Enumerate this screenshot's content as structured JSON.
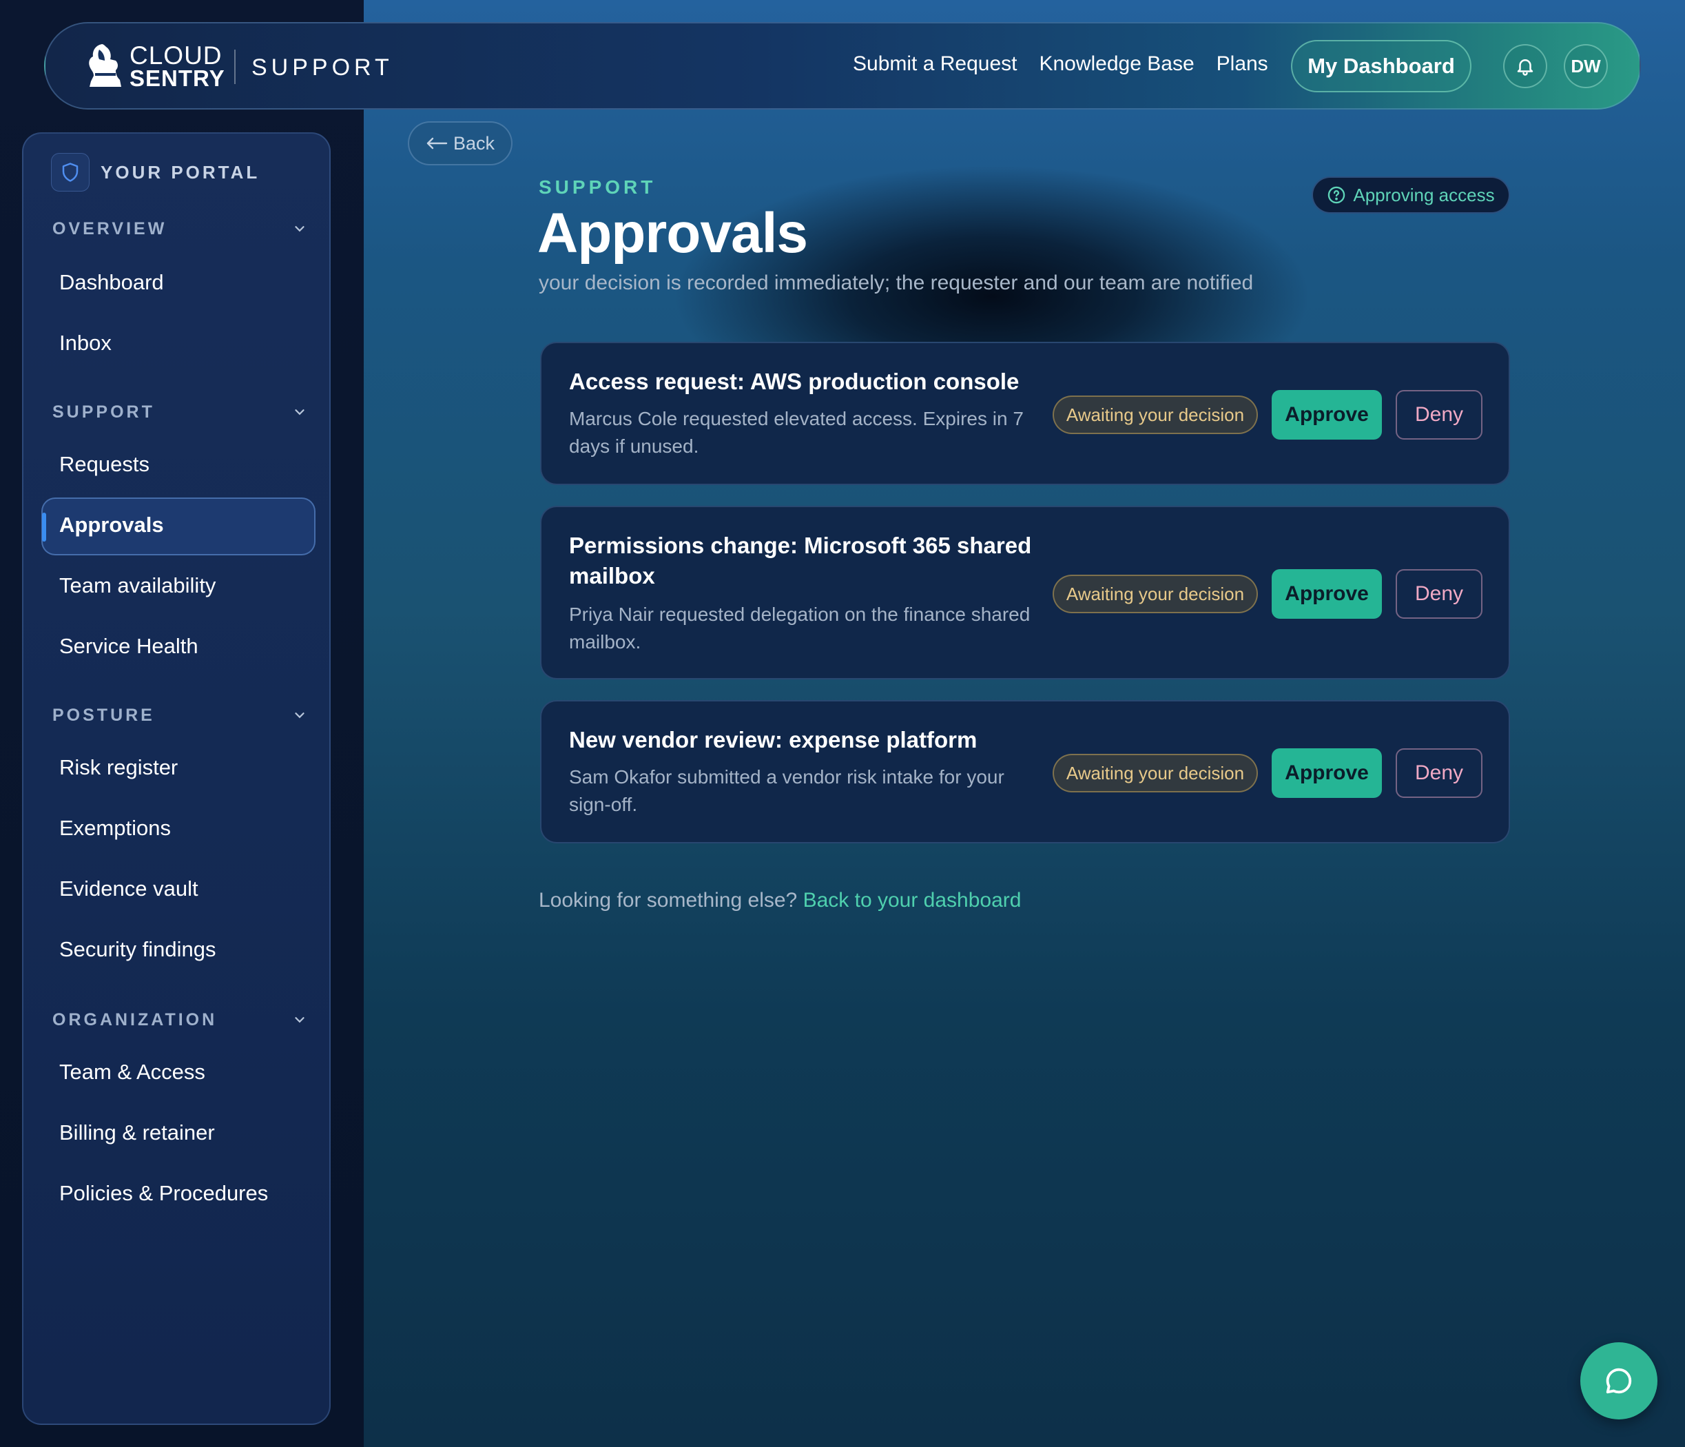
{
  "header": {
    "logo_line1": "CLOUD",
    "logo_line2": "SENTRY",
    "brand_sub": "SUPPORT",
    "nav": [
      "Submit a Request",
      "Knowledge Base",
      "Plans"
    ],
    "dashboard_button": "My Dashboard",
    "avatar_initials": "DW"
  },
  "sidebar": {
    "portal_label": "YOUR PORTAL",
    "sections": [
      {
        "title": "OVERVIEW",
        "items": [
          "Dashboard",
          "Inbox"
        ]
      },
      {
        "title": "SUPPORT",
        "items": [
          "Requests",
          "Approvals",
          "Team availability",
          "Service Health"
        ]
      },
      {
        "title": "POSTURE",
        "items": [
          "Risk register",
          "Exemptions",
          "Evidence vault",
          "Security findings"
        ]
      },
      {
        "title": "ORGANIZATION",
        "items": [
          "Team & Access",
          "Billing & retainer",
          "Policies & Procedures"
        ]
      }
    ],
    "active_item": "Approvals"
  },
  "main": {
    "back_label": "Back",
    "eyebrow": "SUPPORT",
    "title": "Approvals",
    "subtitle": "your decision is recorded immediately; the requester and our team are notified",
    "context_pill": "Approving access",
    "cards": [
      {
        "title": "Access request: AWS production console",
        "description": "Marcus Cole requested elevated access. Expires in 7 days if unused.",
        "status": "Awaiting your decision",
        "approve": "Approve",
        "deny": "Deny"
      },
      {
        "title": "Permissions change: Microsoft 365 shared mailbox",
        "description": "Priya Nair requested delegation on the finance shared mailbox.",
        "status": "Awaiting your decision",
        "approve": "Approve",
        "deny": "Deny"
      },
      {
        "title": "New vendor review: expense platform",
        "description": "Sam Okafor submitted a vendor risk intake for your sign-off.",
        "status": "Awaiting your decision",
        "approve": "Approve",
        "deny": "Deny"
      }
    ],
    "footer_text": "Looking for something else?",
    "footer_link": "Back to your dashboard"
  },
  "colors": {
    "accent": "#25b595",
    "status_awaiting": "#e7c98a",
    "deny": "#f0a9c4",
    "sidebar_bg": "#142a54"
  },
  "icons": {
    "logo": "spartan-helmet-icon",
    "bell": "bell-icon",
    "portal": "shield-icon",
    "section_toggle": "chevron-down-icon",
    "back": "arrow-left-icon",
    "context": "question-circle-icon",
    "chat": "chat-bubble-icon"
  }
}
